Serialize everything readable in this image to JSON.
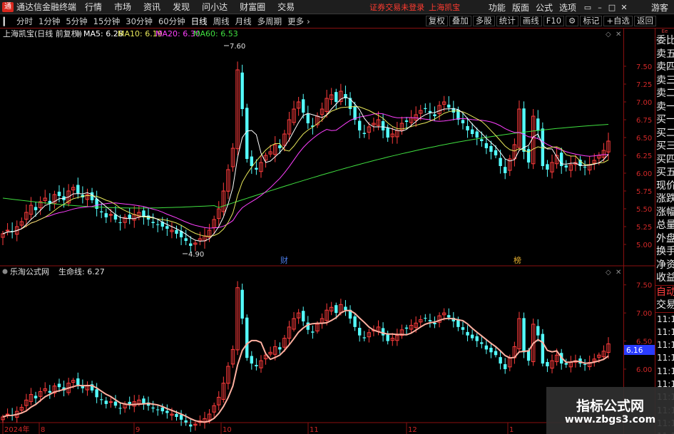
{
  "app": {
    "title": "通达信金融终端",
    "logo_text": "通",
    "menu": [
      "行情",
      "市场",
      "资讯",
      "发现",
      "问小达",
      "财富圈",
      "交易"
    ],
    "notice": "证券交易未登录",
    "notice_stock": "上海凯宝",
    "right_menu": [
      "功能",
      "版面",
      "公式",
      "选项"
    ],
    "guest": "游客"
  },
  "toolbar": {
    "periods": [
      "分时",
      "1分钟",
      "5分钟",
      "15分钟",
      "30分钟",
      "60分钟",
      "日线",
      "周线",
      "月线",
      "多周期",
      "更多"
    ],
    "active_period": "日线",
    "buttons": [
      "复权",
      "叠加",
      "多股",
      "统计",
      "画线",
      "F10",
      "标记",
      "+自选",
      "返回"
    ]
  },
  "main_panel": {
    "stock_title": "上海凯宝(日线 前复权)",
    "ma": [
      {
        "label": "MA5: 6.28",
        "color": "#ffffff"
      },
      {
        "label": "MA10: 6.19",
        "color": "#e8e85a"
      },
      {
        "label": "MA20: 6.30",
        "color": "#ff40ff"
      },
      {
        "label": "MA60: 6.53",
        "color": "#40e040"
      }
    ],
    "y_ticks": [
      "7.50",
      "7.25",
      "7.00",
      "6.75",
      "6.50",
      "6.25",
      "6.00",
      "5.75",
      "5.50",
      "5.25",
      "5.00"
    ],
    "ylim": [
      4.85,
      7.65
    ],
    "high_marker": "7.60",
    "low_marker": "4.90",
    "event_labels": [
      {
        "text": "财",
        "color": "#4a7ce8"
      },
      {
        "text": "榜",
        "color": "#e8b030"
      }
    ]
  },
  "sub_panel": {
    "title": "乐淘公式网",
    "indicator": "生命线: 6.27",
    "y_ticks": [
      "7.50",
      "7.00",
      "6.50",
      "6.00"
    ],
    "current_value": "6.16",
    "current_value_color": "#2a3cff"
  },
  "x_axis": {
    "labels": [
      "2024年",
      "8",
      "9",
      "10",
      "11",
      "12",
      "1"
    ]
  },
  "sidebar": {
    "top_label": "Ee",
    "items": [
      "委比",
      "卖五",
      "卖四",
      "卖三",
      "卖二",
      "卖一",
      "买一",
      "买二",
      "买三",
      "买四",
      "买五",
      "现价",
      "涨跌",
      "涨幅",
      "总量",
      "外盘",
      "换手",
      "净资",
      "收益"
    ],
    "items2": [
      "自动",
      "交易"
    ],
    "times": [
      "11:1",
      "11:1",
      "11:1",
      "11:1",
      "11:1",
      "11:1",
      "11:1",
      "11:1",
      "11:1",
      "11:1"
    ]
  },
  "watermark": {
    "title": "指标公式网",
    "url": "www.zbgs3.com"
  },
  "colors": {
    "up": "#ff3c3c",
    "down": "#54ffff",
    "ma5": "#ffffff",
    "ma10": "#e8e85a",
    "ma20": "#ff40ff",
    "ma60": "#40e040",
    "lifeline": "#ffb0a0"
  },
  "chart_data": {
    "type": "candlestick",
    "closes": [
      5.15,
      5.2,
      5.18,
      5.25,
      5.32,
      5.45,
      5.55,
      5.48,
      5.6,
      5.65,
      5.58,
      5.7,
      5.68,
      5.62,
      5.75,
      5.8,
      5.72,
      5.66,
      5.7,
      5.62,
      5.5,
      5.45,
      5.38,
      5.42,
      5.35,
      5.3,
      5.38,
      5.36,
      5.42,
      5.45,
      5.38,
      5.35,
      5.3,
      5.28,
      5.25,
      5.22,
      5.2,
      5.15,
      5.1,
      5.05,
      4.98,
      5.02,
      5.08,
      5.12,
      5.2,
      5.35,
      5.5,
      5.75,
      6.05,
      6.35,
      7.45,
      6.9,
      6.2,
      6.1,
      6.05,
      6.15,
      6.25,
      6.3,
      6.4,
      6.35,
      6.55,
      6.75,
      6.9,
      7.0,
      6.85,
      6.7,
      6.65,
      6.8,
      6.9,
      7.05,
      7.1,
      7.0,
      7.15,
      7.05,
      6.9,
      6.75,
      6.6,
      6.55,
      6.65,
      6.7,
      6.75,
      6.6,
      6.5,
      6.55,
      6.6,
      6.7,
      6.72,
      6.78,
      6.82,
      6.88,
      6.9,
      6.85,
      6.8,
      6.95,
      7.0,
      6.92,
      6.85,
      6.75,
      6.7,
      6.6,
      6.55,
      6.5,
      6.45,
      6.35,
      6.3,
      6.25,
      6.1,
      6.0,
      6.2,
      6.4,
      6.9,
      6.3,
      6.15,
      6.8,
      6.6,
      6.1,
      6.05,
      6.15,
      6.25,
      6.1,
      6.08,
      6.12,
      6.15,
      6.1,
      6.08,
      6.12,
      6.18,
      6.25,
      6.32,
      6.45
    ],
    "ma60_start": 5.65,
    "ma60_end": 6.53,
    "high": 7.6,
    "low": 4.9,
    "latest": {
      "ma5": 6.28,
      "ma10": 6.19,
      "ma20": 6.3,
      "ma60": 6.53,
      "lifeline": 6.27
    }
  }
}
